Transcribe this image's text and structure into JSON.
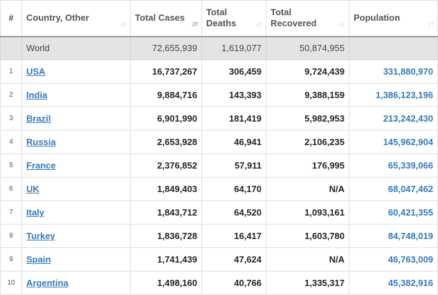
{
  "headers": {
    "num": "#",
    "country": "Country, Other",
    "cases": "Total Cases",
    "deaths": "Total Deaths",
    "recovered": "Total Recovered",
    "population": "Population"
  },
  "world": {
    "name": "World",
    "cases": "72,655,939",
    "deaths": "1,619,077",
    "recovered": "50,874,955",
    "population": ""
  },
  "rows": [
    {
      "num": "1",
      "country": "USA",
      "cases": "16,737,267",
      "deaths": "306,459",
      "recovered": "9,724,439",
      "population": "331,880,970"
    },
    {
      "num": "2",
      "country": "India",
      "cases": "9,884,716",
      "deaths": "143,393",
      "recovered": "9,388,159",
      "population": "1,386,123,196"
    },
    {
      "num": "3",
      "country": "Brazil",
      "cases": "6,901,990",
      "deaths": "181,419",
      "recovered": "5,982,953",
      "population": "213,242,430"
    },
    {
      "num": "4",
      "country": "Russia",
      "cases": "2,653,928",
      "deaths": "46,941",
      "recovered": "2,106,235",
      "population": "145,962,904"
    },
    {
      "num": "5",
      "country": "France",
      "cases": "2,376,852",
      "deaths": "57,911",
      "recovered": "176,995",
      "population": "65,339,066"
    },
    {
      "num": "6",
      "country": "UK",
      "cases": "1,849,403",
      "deaths": "64,170",
      "recovered": "N/A",
      "population": "68,047,462"
    },
    {
      "num": "7",
      "country": "Italy",
      "cases": "1,843,712",
      "deaths": "64,520",
      "recovered": "1,093,161",
      "population": "60,421,355"
    },
    {
      "num": "8",
      "country": "Turkey",
      "cases": "1,836,728",
      "deaths": "16,417",
      "recovered": "1,603,780",
      "population": "84,748,019"
    },
    {
      "num": "9",
      "country": "Spain",
      "cases": "1,741,439",
      "deaths": "47,624",
      "recovered": "N/A",
      "population": "46,763,009"
    },
    {
      "num": "10",
      "country": "Argentina",
      "cases": "1,498,160",
      "deaths": "40,766",
      "recovered": "1,335,317",
      "population": "45,382,916"
    }
  ],
  "sort_icon": "sort-arrows-icon",
  "colors": {
    "link": "#337ab7",
    "world_row_bg": "#e4e4e4",
    "header_border": "#9a9a9a"
  }
}
